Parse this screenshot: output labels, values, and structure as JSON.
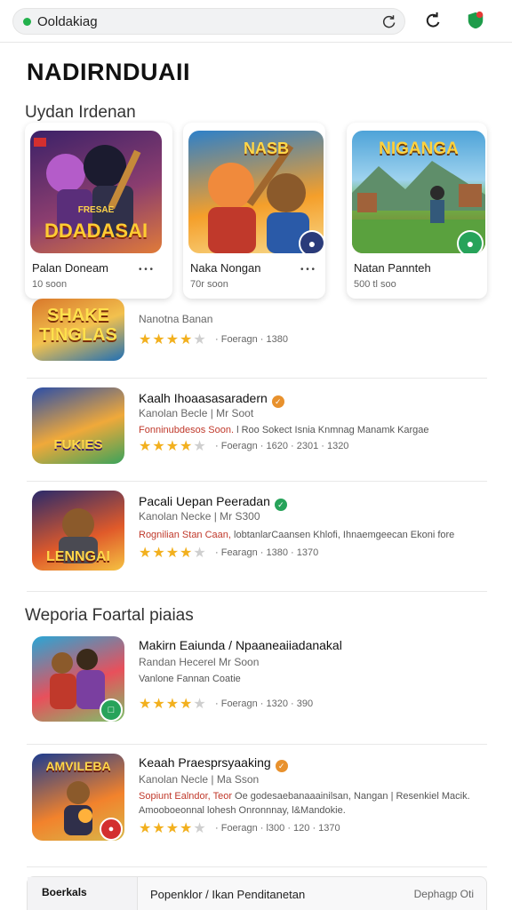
{
  "browser": {
    "url_text": "Ooldakiag"
  },
  "page": {
    "title": "NADIRNDUAII"
  },
  "sections": {
    "featured": "Uydan Irdenan",
    "popular": "Weporia Foartal piaias"
  },
  "featured": [
    {
      "name": "Palan Doneam",
      "sub": "10 soon",
      "dots": "• • •",
      "art_text": "DDADASAI",
      "art_top": "FRESAE",
      "colors": [
        "#3b2168",
        "#8a3d6f",
        "#e07b39"
      ]
    },
    {
      "name": "Naka Nongan",
      "sub": "70r soon",
      "dots": "• • •",
      "art_text": "NASB",
      "colors": [
        "#2e80c9",
        "#f59f2a",
        "#f7d98b"
      ]
    },
    {
      "name": "Natan Pannteh",
      "sub": "500 tl soo",
      "dots": "• • •",
      "art_text": "NIGANGA",
      "colors": [
        "#4ea3d8",
        "#6bb547",
        "#8b5a2b"
      ]
    }
  ],
  "list": [
    {
      "title": "",
      "dev": "Nanotna Banan",
      "desc_accent": "",
      "desc": "",
      "desc2": "",
      "meta": "·  Foeragn  ·  1380",
      "art_text": "SHAKE TINGLAS",
      "colors": [
        "#d9782b",
        "#f2c14e",
        "#1f6fb5"
      ]
    },
    {
      "title": "Kaalh Ihoaasasaradern",
      "dev": "Kanolan Becle | Mr Soot",
      "desc_accent": "Fonninubdesos Soon. ",
      "desc": "l Roo Sokect Isnia Knmnag Manamk Kargae",
      "desc2": "",
      "meta": "·  Foeragn  ·  1620  ·  2301  ·  1320",
      "art_text": "FUKIES",
      "colors": [
        "#2b4ea8",
        "#f0a93a",
        "#3aa35b"
      ]
    },
    {
      "title": "Pacali Uepan Peeradan",
      "dev": "Kanolan Necke | Mr S300",
      "desc_accent": "Rognilian Stan Caan, ",
      "desc": "lobtanlarCaansen Khlofi, Ihnaemgeecan Ekoni fore",
      "desc2": "",
      "meta": "·  Fearagn  ·  1380  ·  1370",
      "art_text": "LENNGAI",
      "colors": [
        "#2a2a6b",
        "#e05a2a",
        "#f5c242"
      ]
    },
    {
      "title": "Makirn Eaiunda / Npaaneaiiadanakal",
      "dev": "Randan Hecerel Mr Soon",
      "desc_accent": "",
      "desc": "Vanlone Fannan Coatie",
      "desc2": "",
      "meta": "·  Foeragn  ·  1320  ·  390",
      "art_text": "",
      "colors": [
        "#29a6d6",
        "#e8505b",
        "#7cc26b"
      ]
    },
    {
      "title": "Keaah Praesprsyaaking",
      "dev": "Kanolan Necle | Ma Sson",
      "desc_accent": "Sopiunt Ealndor, Teor ",
      "desc": "Oe godesaebanaaainilsan, Nangan | Resenkiel Macik.",
      "desc2": "Amooboeonnal lohesh Onronnnay, l&Mandokie.",
      "meta": "·  Foeragn  ·  l300  ·  120  ·  1370",
      "art_text": "AMVILEBA",
      "colors": [
        "#1d3c8f",
        "#f2822c",
        "#d8b84a"
      ]
    }
  ],
  "bottom": {
    "thumb_title": "Boerkals",
    "name": "Popenklor / Ikan Penditanetan",
    "right": "Dephagp Oti"
  },
  "colors": {
    "star": "#f2b01e",
    "accent_text": "#c0392b",
    "badge_orange": "#e8912d",
    "badge_green": "#27a35a"
  }
}
